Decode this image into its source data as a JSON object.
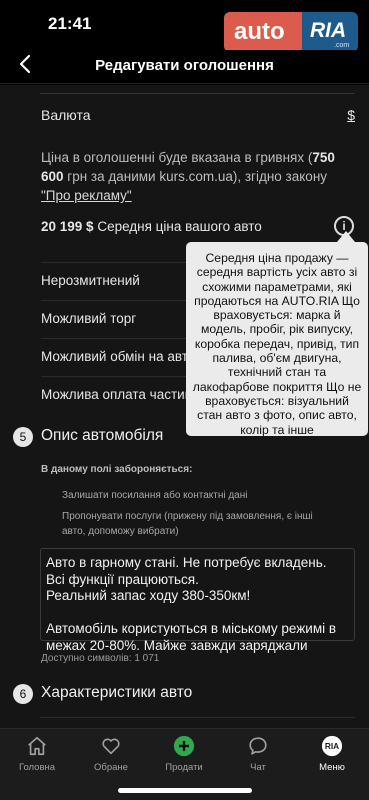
{
  "status": {
    "time": "21:41"
  },
  "logo": {
    "auto": "auto",
    "ria": "RIA",
    "domain": ".com"
  },
  "header": {
    "title": "Редагувати оголошення"
  },
  "currency": {
    "label": "Валюта",
    "value": "$"
  },
  "price_note": {
    "text_before": "Ціна в оголошенні буде вказана в гривнях (",
    "amount": "750 600",
    "text_after": " грн за даними kurs.com.ua), згідно закону ",
    "link": "\"Про рекламу\""
  },
  "avg_price": {
    "amount": "20 199 $",
    "label": " Середня ціна вашого авто"
  },
  "tooltip": {
    "text": "Середня ціна продажу — середня вартість усіх авто зі схожими параметрами, які продаються на AUTO.RIA Що враховується: марка й модель, пробіг, рік випуску, коробка передач, привід, тип палива, об'єм двигуна, технічний стан та лакофарбове покриття Що не враховується: візуальний стан авто з фото, опис авто, колір та інше"
  },
  "options": [
    "Нерозмитнений",
    "Можливий торг",
    "Можливий обмін на авто",
    "Можлива оплата частинами"
  ],
  "section5": {
    "number": "5",
    "title": "Опис автомобіля",
    "forbidden_title": "В даному полі забороняється:",
    "forbidden_items": [
      "Залишати посилання або контактні дані",
      "Пропонувати послуги (прижену під замовлення, є інші авто, допоможу вибрати)"
    ],
    "description": "Авто в гарному стані. Не потребує вкладень.\nВсі функції працюються.\nРеальний запас ходу 380-350км!\n\nАвтомобіль користуються в міському режимі в межах 20-80%. Майже завжди заряджали",
    "chars_left": "Доступно символів: 1 071"
  },
  "section6": {
    "number": "6",
    "title": "Характеристики авто"
  },
  "tabs": [
    {
      "label": "Головна",
      "icon": "home-icon"
    },
    {
      "label": "Обране",
      "icon": "heart-icon"
    },
    {
      "label": "Продати",
      "icon": "plus-circle-icon"
    },
    {
      "label": "Чат",
      "icon": "chat-icon"
    },
    {
      "label": "Меню",
      "icon": "ria-menu-icon"
    }
  ],
  "colors": {
    "accent_green": "#2fa84f",
    "logo_red": "#db5c4c",
    "logo_blue": "#1e5a8c",
    "tooltip_bg": "#ebebeb"
  }
}
